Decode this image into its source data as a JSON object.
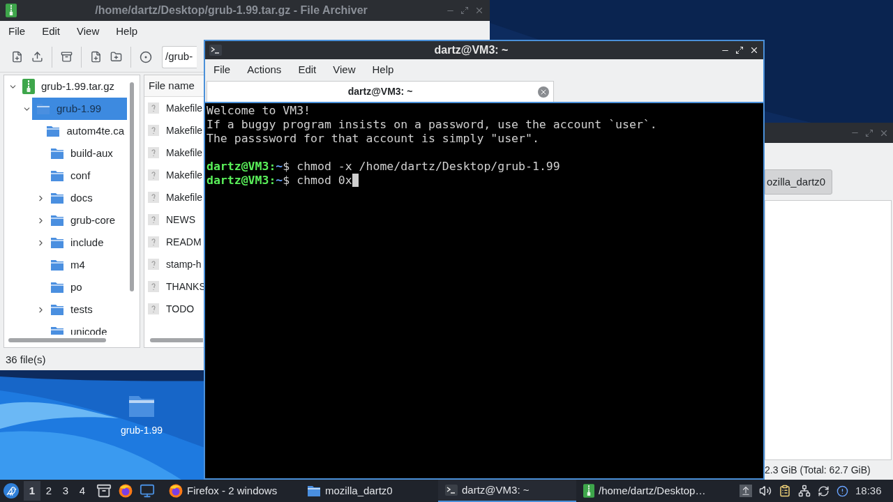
{
  "file_archiver": {
    "title": "/home/dartz/Desktop/grub-1.99.tar.gz - File Archiver",
    "active": false,
    "menu": [
      "File",
      "Edit",
      "View",
      "Help"
    ],
    "location": "/grub-",
    "tree": [
      {
        "label": "grub-1.99.tar.gz",
        "kind": "archive",
        "expanded": true,
        "selected": false,
        "children": [
          {
            "label": "grub-1.99",
            "kind": "folder",
            "expanded": true,
            "selected": true,
            "children": [
              {
                "label": "autom4te.ca",
                "kind": "folder",
                "selected": false
              },
              {
                "label": "build-aux",
                "kind": "folder",
                "selected": false
              },
              {
                "label": "conf",
                "kind": "folder",
                "selected": false
              },
              {
                "label": "docs",
                "kind": "folder",
                "expanded": false,
                "selected": false
              },
              {
                "label": "grub-core",
                "kind": "folder",
                "expanded": false,
                "selected": false
              },
              {
                "label": "include",
                "kind": "folder",
                "expanded": false,
                "selected": false
              },
              {
                "label": "m4",
                "kind": "folder",
                "selected": false
              },
              {
                "label": "po",
                "kind": "folder",
                "selected": false
              },
              {
                "label": "tests",
                "kind": "folder",
                "expanded": false,
                "selected": false
              },
              {
                "label": "unicode",
                "kind": "folder",
                "selected": false
              }
            ]
          }
        ]
      }
    ],
    "file_list": {
      "columns": [
        "File name"
      ],
      "rows": [
        "Makefile",
        "Makefile",
        "Makefile",
        "Makefile",
        "Makefile",
        "NEWS",
        "READM",
        "stamp-h",
        "THANKS",
        "TODO"
      ]
    },
    "status": "36 file(s)"
  },
  "terminal": {
    "title": "dartz@VM3: ~",
    "active": true,
    "menu": [
      "File",
      "Actions",
      "Edit",
      "View",
      "Help"
    ],
    "tab": "dartz@VM3: ~",
    "lines": [
      {
        "kind": "text",
        "text": "Welcome to VM3!"
      },
      {
        "kind": "text",
        "text": "If a buggy program insists on a password, use the account `user`."
      },
      {
        "kind": "text",
        "text": "The passsword for that account is simply \"user\"."
      },
      {
        "kind": "blank"
      },
      {
        "kind": "prompt",
        "user_host": "dartz@VM3:",
        "path": "~",
        "symbol": "$",
        "command": "chmod -x /home/dartz/Desktop/grub-1.99",
        "cursor": false
      },
      {
        "kind": "prompt",
        "user_host": "dartz@VM3:",
        "path": "~",
        "symbol": "$",
        "command": "chmod 0x",
        "cursor": true
      }
    ]
  },
  "file_manager": {
    "path_button": "ozilla_dartz0",
    "status": "2.3 GiB (Total: 62.7 GiB)"
  },
  "desktop_icons": [
    {
      "label": "grub-1.99"
    }
  ],
  "taskbar": {
    "workspaces": [
      {
        "label": "1",
        "selected": true
      },
      {
        "label": "2",
        "selected": false
      },
      {
        "label": "3",
        "selected": false
      },
      {
        "label": "4",
        "selected": false
      }
    ],
    "tasks": [
      {
        "label": "Firefox - 2 windows",
        "kind": "firefox",
        "active": false
      },
      {
        "label": "mozilla_dartz0",
        "kind": "folder",
        "active": false
      },
      {
        "label": "dartz@VM3: ~",
        "kind": "terminal",
        "active": true
      },
      {
        "label": "/home/dartz/Desktop…",
        "kind": "archive",
        "active": false
      }
    ],
    "clock": "18:36"
  }
}
